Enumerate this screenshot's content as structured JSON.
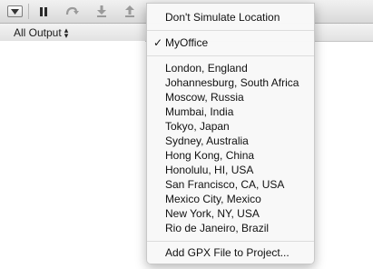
{
  "toolbar": {
    "buttons": [
      {
        "name": "hide-debug-area-button",
        "icon": "panel-toggle-icon"
      },
      {
        "name": "pause-button",
        "icon": "pause-icon"
      },
      {
        "name": "step-over-button",
        "icon": "step-over-icon"
      },
      {
        "name": "step-into-button",
        "icon": "step-into-icon"
      },
      {
        "name": "step-out-button",
        "icon": "step-out-icon"
      },
      {
        "name": "simulate-location-button",
        "icon": "location-arrow-icon"
      }
    ]
  },
  "output": {
    "selector_label": "All Output"
  },
  "menu": {
    "dont_simulate": "Don't Simulate Location",
    "checked_item": "MyOffice",
    "checkmark": "✓",
    "locations": [
      "London, England",
      "Johannesburg, South Africa",
      "Moscow, Russia",
      "Mumbai, India",
      "Tokyo, Japan",
      "Sydney, Australia",
      "Hong Kong, China",
      "Honolulu, HI, USA",
      "San Francisco, CA, USA",
      "Mexico City, Mexico",
      "New York, NY, USA",
      "Rio de Janeiro, Brazil"
    ],
    "add_gpx": "Add GPX File to Project..."
  }
}
